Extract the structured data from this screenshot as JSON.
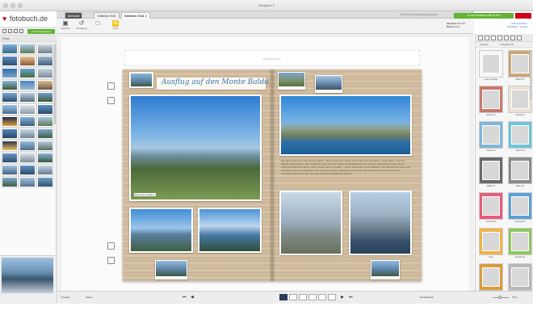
{
  "window": {
    "title": "Designer 3"
  },
  "brand": {
    "name": "fotobuch.de",
    "button": "Fotos hinzufügen"
  },
  "left_panel": {
    "header": "Fotos"
  },
  "tabs": [
    {
      "label": "Übersicht",
      "style": "dark"
    },
    {
      "label": "Seitleiste 2018",
      "style": "light"
    },
    {
      "label": "Seitleiste 2018_2",
      "style": "active"
    }
  ],
  "toolbar": {
    "items": [
      {
        "label": "Speichern",
        "icon": "save-icon",
        "glyph": "▣"
      },
      {
        "label": "Rückgängig",
        "icon": "undo-icon",
        "glyph": "↺"
      },
      {
        "label": "",
        "icon": "redo-icon",
        "glyph": "□"
      },
      {
        "label": "Tipps",
        "icon": "lightbulb-icon",
        "glyph": "☀"
      }
    ]
  },
  "header_right": {
    "info": "Ihr Produkt wird automatisch gespeichert",
    "order_button": "IN DEN WARENKORB 54,95 €",
    "format_label": "Abstand",
    "format_value": "Schmal",
    "binding_label": "Rand",
    "binding_value": "Linien",
    "link1": "Jetzt speichern",
    "link2": "Schließen / Logout"
  },
  "book": {
    "cover_hint": "Einband-Rücken",
    "title": "Ausflug auf den Monte Baldo",
    "photo_caption": "Blick auf den Gardasee",
    "body_text": "Die Bergwelt auf dem Monte Baldo. Hier leben mit freier Sicht auf den Gardasee, Malcesine und die Hänge des Berges. Der Ausblick von oben ist einfach atemberaubend und die Seilbahn bringt uns in wenigen Minuten nach oben. Viele Tiere gesehen – unter anderem auch Gämsen. Die Bergwege sind gut markiert und wir wandern durch Wiesen voller Blumen, bevor wir am Nachmittag wieder ins Tal zurückkehren und den Tag am Seeufer ausklingen lassen."
  },
  "right_panel": {
    "tabs": [
      "Layouts",
      "Hintergründe"
    ],
    "layouts": [
      {
        "label": "Leere Vorlage",
        "frame": "#f7f7f7"
      },
      {
        "label": "Album 01",
        "frame": "#c9a877"
      },
      {
        "label": "Album 02",
        "frame": "#c97a6a"
      },
      {
        "label": "Album 03",
        "frame": "#e9e3d7"
      },
      {
        "label": "Album 04",
        "frame": "#7fb7d9"
      },
      {
        "label": "Album 05",
        "frame": "#72c3da"
      },
      {
        "label": "Basic 01",
        "frame": "#6a6a6a"
      },
      {
        "label": "Basic 02",
        "frame": "#8c8c8c"
      },
      {
        "label": "Carnival 01",
        "frame": "#e85c7a"
      },
      {
        "label": "Carnival 02",
        "frame": "#5aa0d8"
      },
      {
        "label": "Dots",
        "frame": "#f0b24a"
      },
      {
        "label": "Doodle 01",
        "frame": "#8fc65f"
      },
      {
        "label": "Doodle 02",
        "frame": "#d99c3b"
      },
      {
        "label": "Doodle 03",
        "frame": "#b8b8b8"
      }
    ]
  },
  "bottom_bar": {
    "product": "Produkt",
    "pages": "Seiten",
    "view": "Detailansicht",
    "zoom": "75%"
  }
}
